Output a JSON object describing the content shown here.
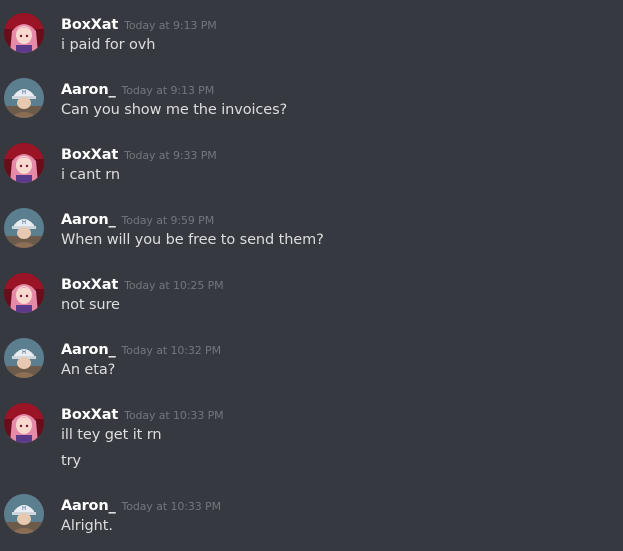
{
  "chat": {
    "messages": [
      {
        "author": "BoxXat",
        "timestamp": "Today at 9:13 PM",
        "avatar_icon": "anime-pink-hair-avatar",
        "lines": [
          "i paid for ovh"
        ]
      },
      {
        "author": "Aaron_",
        "timestamp": "Today at 9:13 PM",
        "avatar_icon": "cap-person-avatar",
        "lines": [
          "Can you show me the invoices?"
        ]
      },
      {
        "author": "BoxXat",
        "timestamp": "Today at 9:33 PM",
        "avatar_icon": "anime-pink-hair-avatar",
        "lines": [
          "i cant rn"
        ]
      },
      {
        "author": "Aaron_",
        "timestamp": "Today at 9:59 PM",
        "avatar_icon": "cap-person-avatar",
        "lines": [
          "When will you be free to send them?"
        ]
      },
      {
        "author": "BoxXat",
        "timestamp": "Today at 10:25 PM",
        "avatar_icon": "anime-pink-hair-avatar",
        "lines": [
          "not sure"
        ]
      },
      {
        "author": "Aaron_",
        "timestamp": "Today at 10:32 PM",
        "avatar_icon": "cap-person-avatar",
        "lines": [
          "An eta?"
        ]
      },
      {
        "author": "BoxXat",
        "timestamp": "Today at 10:33 PM",
        "avatar_icon": "anime-pink-hair-avatar",
        "lines": [
          "ill tey get it rn",
          "try"
        ]
      },
      {
        "author": "Aaron_",
        "timestamp": "Today at 10:33 PM",
        "avatar_icon": "cap-person-avatar",
        "lines": [
          "Alright."
        ]
      }
    ]
  },
  "colors": {
    "background": "#36393f",
    "username": "#ffffff",
    "timestamp": "#72767d",
    "message_text": "#dcddde"
  }
}
